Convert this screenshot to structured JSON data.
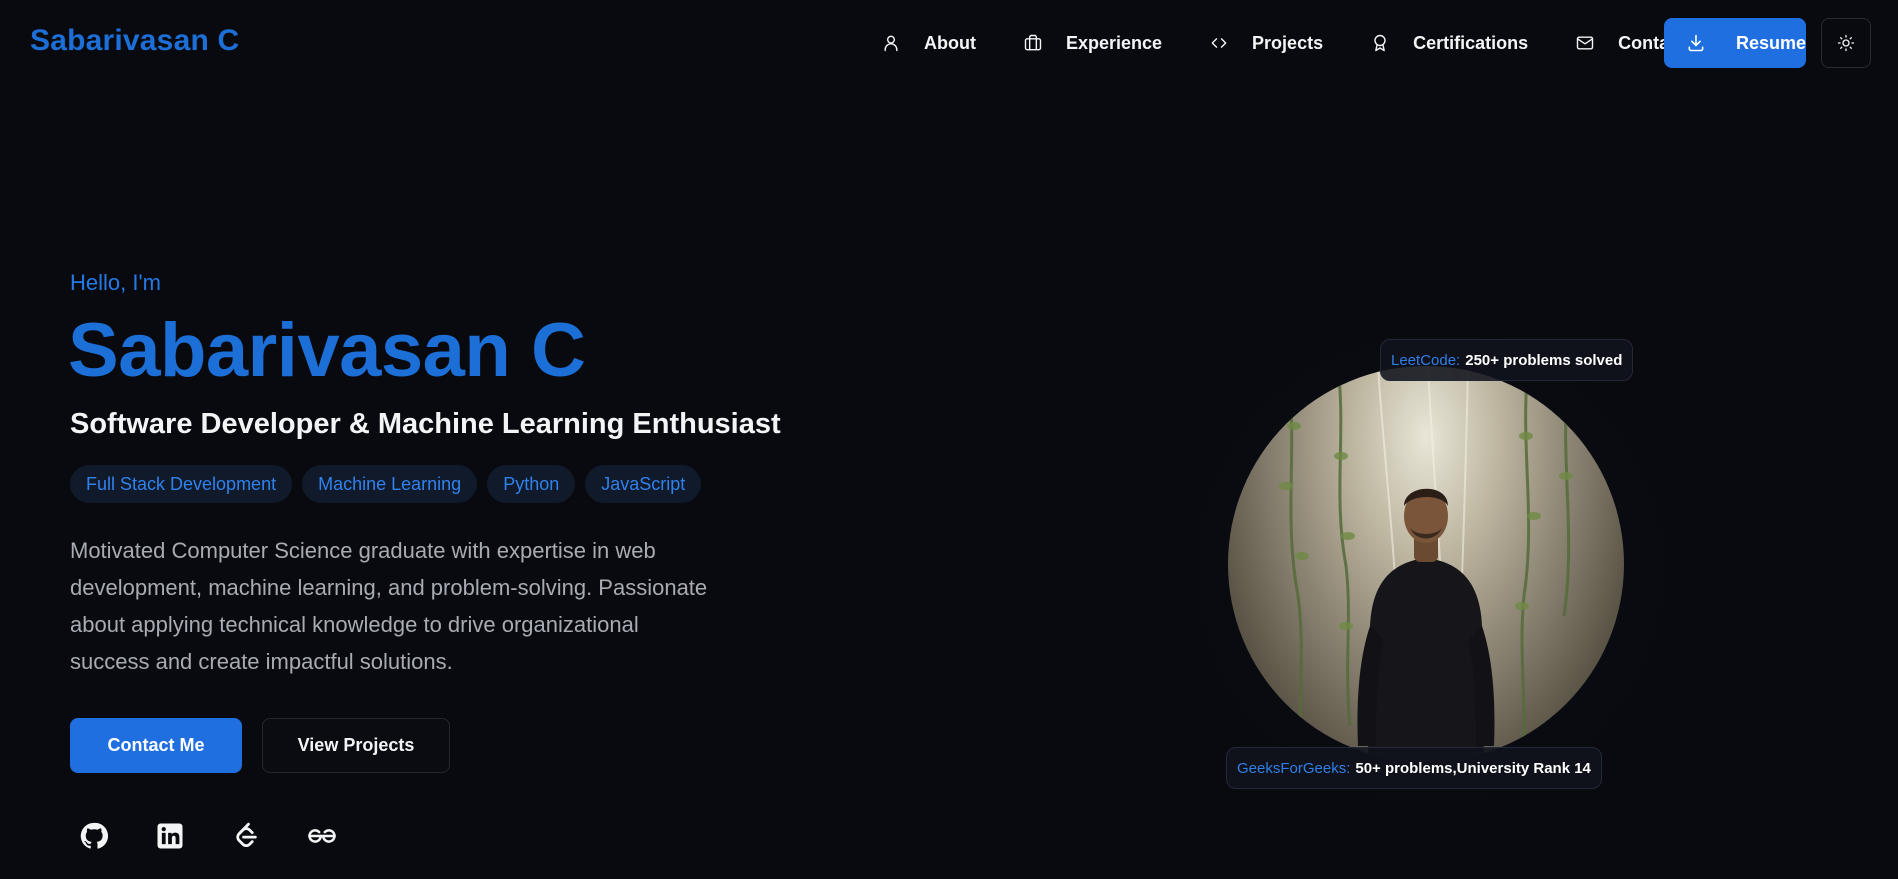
{
  "brand": "Sabarivasan C",
  "nav": {
    "items": [
      {
        "label": "About",
        "icon": "user-icon"
      },
      {
        "label": "Experience",
        "icon": "briefcase-icon"
      },
      {
        "label": "Projects",
        "icon": "code-icon"
      },
      {
        "label": "Certifications",
        "icon": "award-icon"
      },
      {
        "label": "Contact",
        "icon": "mail-icon"
      }
    ],
    "resume_label": "Resume",
    "theme_icon": "sun-icon"
  },
  "hero": {
    "greeting": "Hello, I'm",
    "name": "Sabarivasan C",
    "role": "Software Developer & Machine Learning Enthusiast",
    "tags": [
      "Full Stack Development",
      "Machine Learning",
      "Python",
      "JavaScript"
    ],
    "bio": "Motivated Computer Science graduate with expertise in web development, machine learning, and problem-solving. Passionate about applying technical knowledge to drive organizational success and create impactful solutions.",
    "contact_label": "Contact Me",
    "projects_label": "View Projects",
    "socials": [
      "github-icon",
      "linkedin-icon",
      "leetcode-icon",
      "geeksforgeeks-icon"
    ]
  },
  "profile": {
    "leetcode_key": "LeetCode:",
    "leetcode_value": "250+ problems solved",
    "gfg_key": "GeeksForGeeks:",
    "gfg_value": "50+ problems,University Rank 14"
  },
  "colors": {
    "accent": "#1d6fd8",
    "button": "#1f6fe0",
    "background": "#090a0f",
    "tag_bg": "#111a2b",
    "muted_text": "#a7abb3"
  }
}
